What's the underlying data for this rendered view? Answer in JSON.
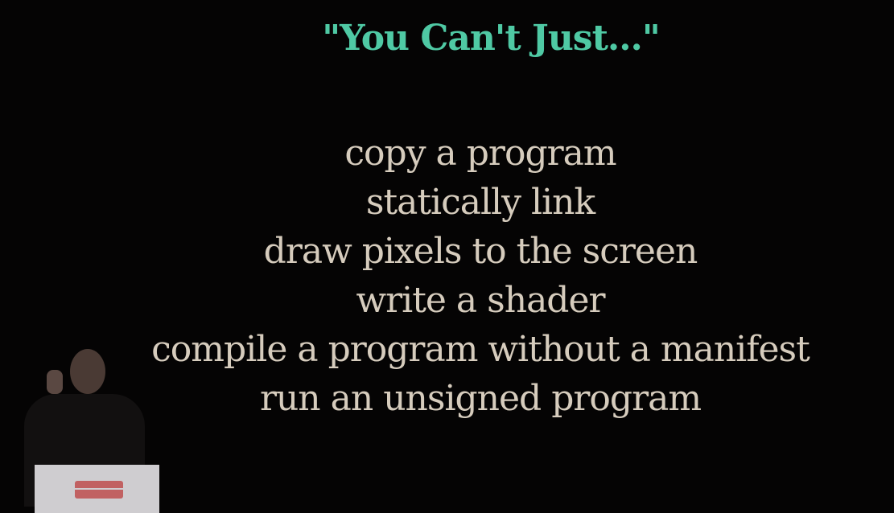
{
  "slide": {
    "title": "\"You Can't Just...\"",
    "items": [
      "copy a program",
      "statically link",
      "draw pixels to the screen",
      "write a shader",
      "compile a program without a manifest",
      "run an unsigned program"
    ]
  },
  "colors": {
    "background": "#050404",
    "title": "#4fc9a4",
    "text": "#d6ccbd"
  }
}
